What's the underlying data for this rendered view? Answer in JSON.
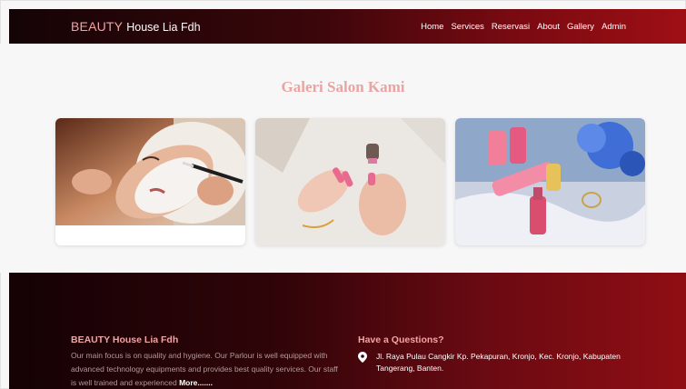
{
  "navbar": {
    "brand_accent": "BEAUTY",
    "brand_rest": "House Lia Fdh",
    "links": [
      "Home",
      "Services",
      "Reservasi",
      "About",
      "Gallery",
      "Admin"
    ]
  },
  "gallery": {
    "title": "Galeri Salon Kami"
  },
  "footer": {
    "brand_title": "BEAUTY House Lia Fdh",
    "description": "Our main focus is on quality and hygiene. Our Parlour is well equipped with advanced technology equipments and provides best quality services. Our staff is well trained and experienced",
    "more_label": "More.......",
    "contact_heading": "Have a Questions?",
    "address": "Jl. Raya Pulau Cangkir Kp. Pekapuran, Kronjo, Kec. Kronjo, Kabupaten Tangerang, Banten."
  },
  "icons": {
    "address": "map-pin-icon"
  },
  "colors": {
    "accent_pink": "#f2a3a3",
    "nav_dark": "#140406",
    "nav_red": "#9e0f14"
  }
}
